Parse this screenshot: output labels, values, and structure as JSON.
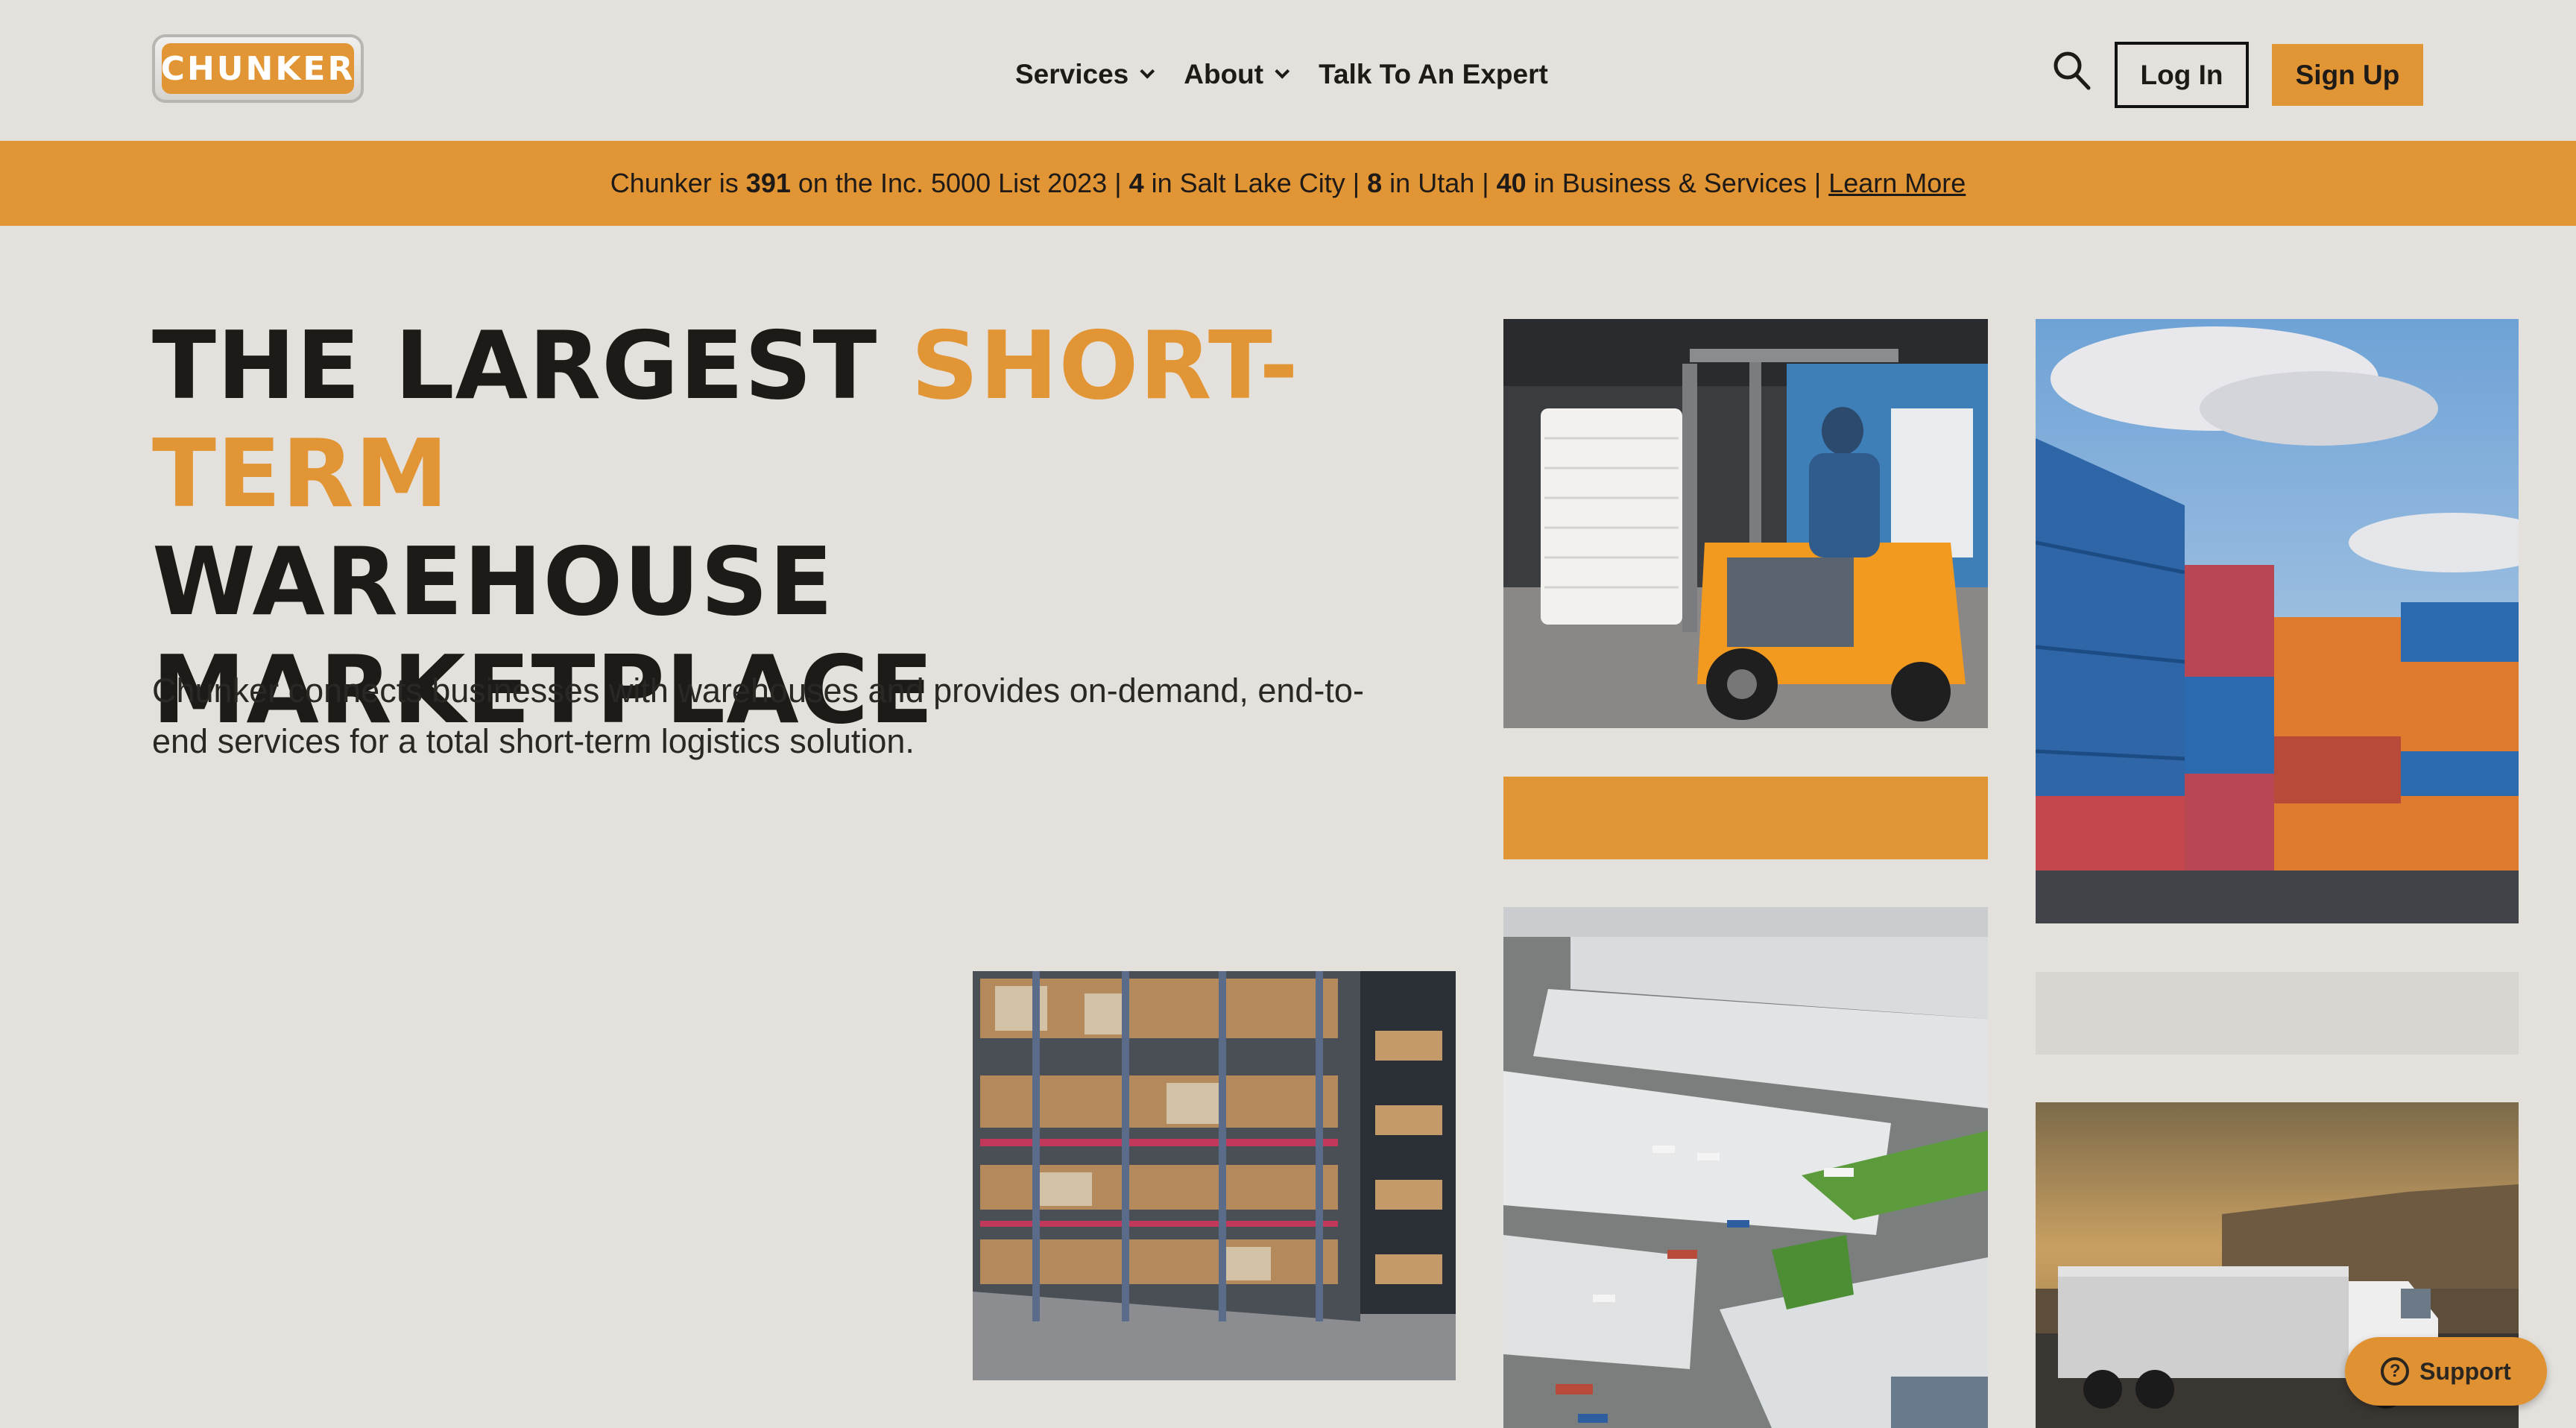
{
  "logo": {
    "text": "CHUNKER"
  },
  "nav": {
    "items": [
      {
        "label": "Services"
      },
      {
        "label": "About"
      },
      {
        "label": "Talk To An Expert"
      }
    ],
    "login_label": "Log In",
    "signup_label": "Sign Up"
  },
  "banner": {
    "p1": "Chunker is",
    "n1": "391",
    "p2": "on the Inc. 5000 List 2023 |",
    "n2": "4",
    "p3": "in Salt Lake City |",
    "n3": "8",
    "p4": "in Utah |",
    "n4": "40",
    "p5": "in Business & Services |",
    "link": "Learn More"
  },
  "hero": {
    "title_part1": "THE LARGEST",
    "title_highlight": "SHORT-TERM",
    "title_line2": "WAREHOUSE",
    "title_line3": "MARKETPLACE",
    "description": "Chunker connects businesses with warehouses and provides on-demand, end-to-end services for a total short-term logistics solution."
  },
  "support": {
    "label": "Support"
  },
  "colors": {
    "accent": "#e29535",
    "background": "#e4e1dd",
    "text": "#1d1a17"
  },
  "icons": [
    "search-icon",
    "chevron-down-icon",
    "question-icon"
  ]
}
